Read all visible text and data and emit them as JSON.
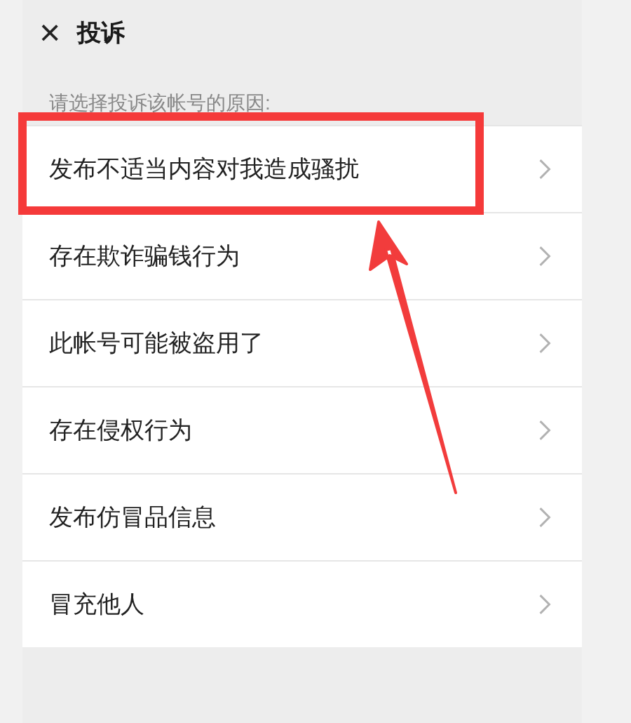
{
  "header": {
    "close_icon": "×",
    "title": "投诉"
  },
  "prompt": "请选择投诉该帐号的原因:",
  "reasons": [
    {
      "label": "发布不适当内容对我造成骚扰",
      "highlighted": true
    },
    {
      "label": "存在欺诈骗钱行为",
      "highlighted": false
    },
    {
      "label": "此帐号可能被盗用了",
      "highlighted": false
    },
    {
      "label": "存在侵权行为",
      "highlighted": false
    },
    {
      "label": "发布仿冒品信息",
      "highlighted": false
    },
    {
      "label": "冒充他人",
      "highlighted": false
    }
  ]
}
